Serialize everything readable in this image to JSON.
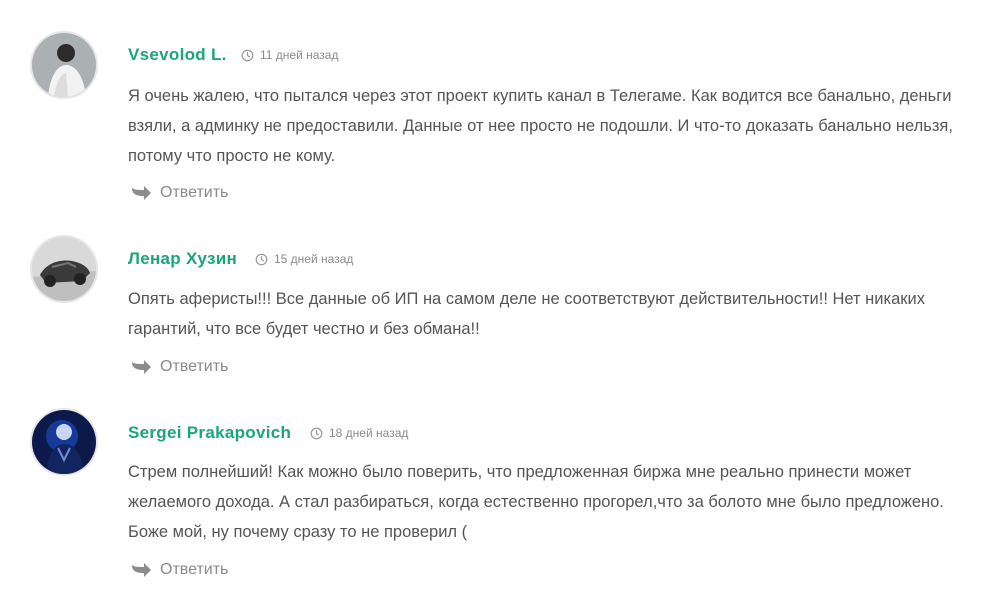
{
  "comments": [
    {
      "author": "Vsevolod L.",
      "time": "11 дней назад",
      "text": "Я очень жалею, что пытался через этот проект купить канал в Телегаме. Как водится все банально, деньги взяли, а админку не предоставили. Данные от нее просто не подошли. И что-то доказать банально нельзя, потому что просто не кому.",
      "reply_label": "Ответить"
    },
    {
      "author": "Ленар Хузин",
      "time": "15 дней назад",
      "text": "Опять аферисты!!! Все данные об ИП на самом деле не соответствуют действительности!! Нет никаких гарантий, что все будет честно и без обмана!!",
      "reply_label": "Ответить"
    },
    {
      "author": "Sergei Prakapovich",
      "time": "18 дней назад",
      "text": "Стрем полнейший! Как можно было поверить, что предложенная биржа мне реально принести может желаемого дохода. А стал разбираться, когда естественно прогорел,что за болото мне было предложено. Боже мой, ну почему сразу то не проверил (",
      "reply_label": "Ответить"
    }
  ],
  "icons": {
    "time": "clock-icon",
    "reply": "reply-arrow-icon"
  },
  "colors": {
    "author": "#1aa67a",
    "text": "#555555",
    "muted": "#8a8a8a"
  }
}
